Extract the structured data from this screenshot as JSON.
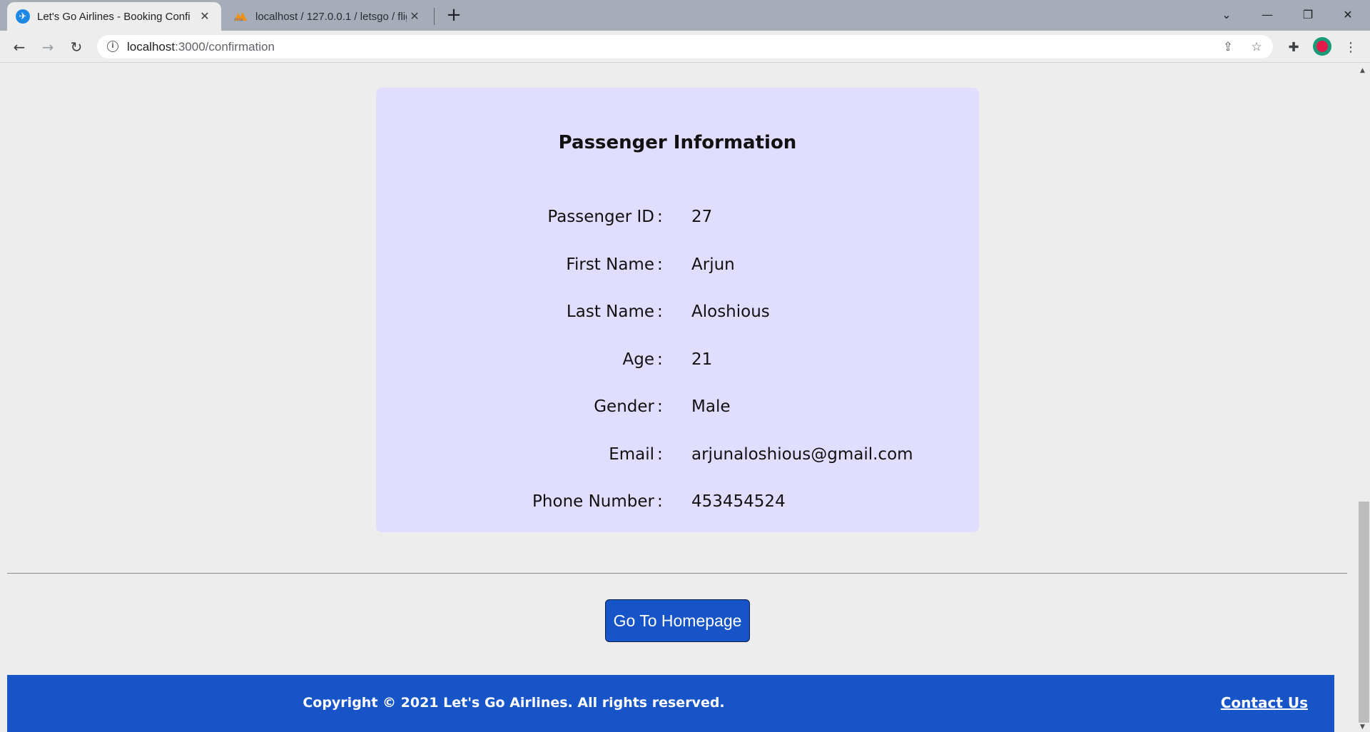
{
  "browser": {
    "tabs": [
      {
        "title": "Let's Go Airlines - Booking Confi",
        "active": true,
        "icon": "plane-icon"
      },
      {
        "title": "localhost / 127.0.0.1 / letsgo / flig",
        "active": false,
        "icon": "phpmyadmin-icon"
      }
    ],
    "url_host": "localhost",
    "url_path": ":3000/confirmation"
  },
  "card": {
    "title": "Passenger Information",
    "colon": ":",
    "rows": [
      {
        "label": "Passenger ID",
        "value": "27"
      },
      {
        "label": "First Name",
        "value": "Arjun"
      },
      {
        "label": "Last Name",
        "value": "Aloshious"
      },
      {
        "label": "Age",
        "value": "21"
      },
      {
        "label": "Gender",
        "value": "Male"
      },
      {
        "label": "Email",
        "value": "arjunaloshious@gmail.com"
      },
      {
        "label": "Phone Number",
        "value": "453454524"
      }
    ]
  },
  "actions": {
    "home_label": "Go To Homepage"
  },
  "footer": {
    "copyright": "Copyright © 2021 Let's Go Airlines. All rights reserved.",
    "contact": "Contact Us"
  },
  "colors": {
    "brand": "#1654c8",
    "card_bg": "#e0ddff",
    "page_bg": "#ededed"
  }
}
